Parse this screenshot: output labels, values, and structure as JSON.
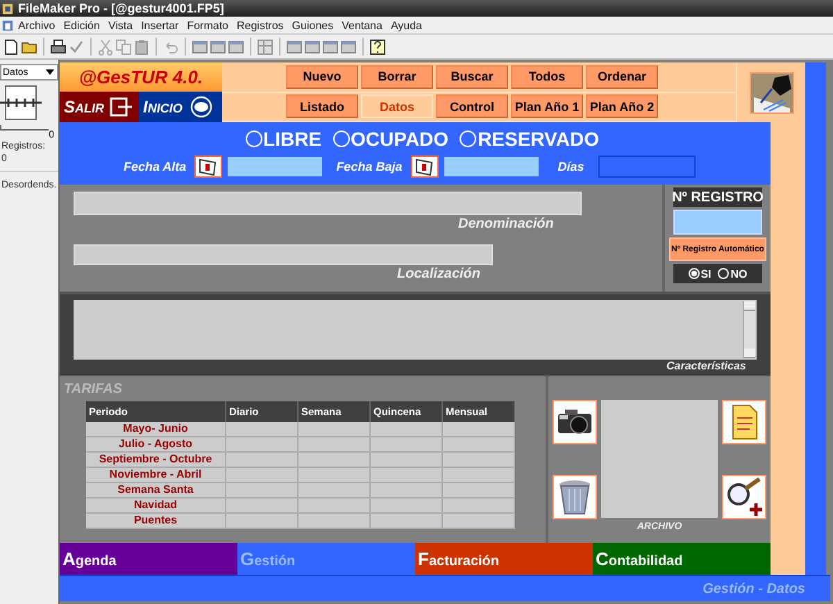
{
  "window": {
    "title": "FileMaker Pro - [@gestur4001.FP5]"
  },
  "menu": [
    "Archivo",
    "Edición",
    "Vista",
    "Insertar",
    "Formato",
    "Registros",
    "Guiones",
    "Ventana",
    "Ayuda"
  ],
  "status_panel": {
    "layout_select": "Datos",
    "book_count": "0",
    "records_label": "Registros:",
    "records_value": "0",
    "sort_status": "Desordends."
  },
  "header": {
    "logo": "@GesTUR 4.0.",
    "exit_button": "SALIR",
    "home_button": "INICIO",
    "nav_rows": [
      [
        {
          "label": "Nuevo",
          "selected": false
        },
        {
          "label": "Borrar",
          "selected": false
        },
        {
          "label": "Buscar",
          "selected": false
        },
        {
          "label": "Todos",
          "selected": false
        },
        {
          "label": "Ordenar",
          "selected": false
        }
      ],
      [
        {
          "label": "Listado",
          "selected": false
        },
        {
          "label": "Datos",
          "selected": true
        },
        {
          "label": "Control",
          "selected": false
        },
        {
          "label": "Plan Año 1",
          "selected": false
        },
        {
          "label": "Plan Año 2",
          "selected": false
        }
      ]
    ]
  },
  "status_options": [
    {
      "label": "LIBRE",
      "selected": false
    },
    {
      "label": "OCUPADO",
      "selected": false
    },
    {
      "label": "RESERVADO",
      "selected": false
    }
  ],
  "dates": {
    "start_label": "Fecha Alta",
    "end_label": "Fecha Baja",
    "days_label": "Días"
  },
  "details": {
    "name_label": "Denominación",
    "location_label": "Localización",
    "features_label": "Características"
  },
  "registry": {
    "title": "Nº REGISTRO",
    "auto_button": "Nº Registro Automático",
    "options": [
      {
        "label": "SI",
        "selected": true
      },
      {
        "label": "NO",
        "selected": false
      }
    ]
  },
  "tariffs": {
    "title": "TARIFAS",
    "columns": [
      "Periodo",
      "Diario",
      "Semana",
      "Quincena",
      "Mensual"
    ],
    "rows": [
      {
        "period": "Mayo- Junio"
      },
      {
        "period": "Julio - Agosto"
      },
      {
        "period": "Septiembre - Octubre"
      },
      {
        "period": "Noviembre - Abril"
      },
      {
        "period": "Semana Santa"
      },
      {
        "period": "Navidad"
      },
      {
        "period": "Puentes"
      }
    ]
  },
  "archive": {
    "label": "ARCHIVO"
  },
  "tabs": [
    {
      "label": "Agenda",
      "selected": false,
      "color": "#660099"
    },
    {
      "label": "Gestión",
      "selected": true,
      "color": "#3366ff"
    },
    {
      "label": "Facturación",
      "selected": false,
      "color": "#cc3300"
    },
    {
      "label": "Contabilidad",
      "selected": false,
      "color": "#006600"
    }
  ],
  "footer": "Gestión - Datos"
}
